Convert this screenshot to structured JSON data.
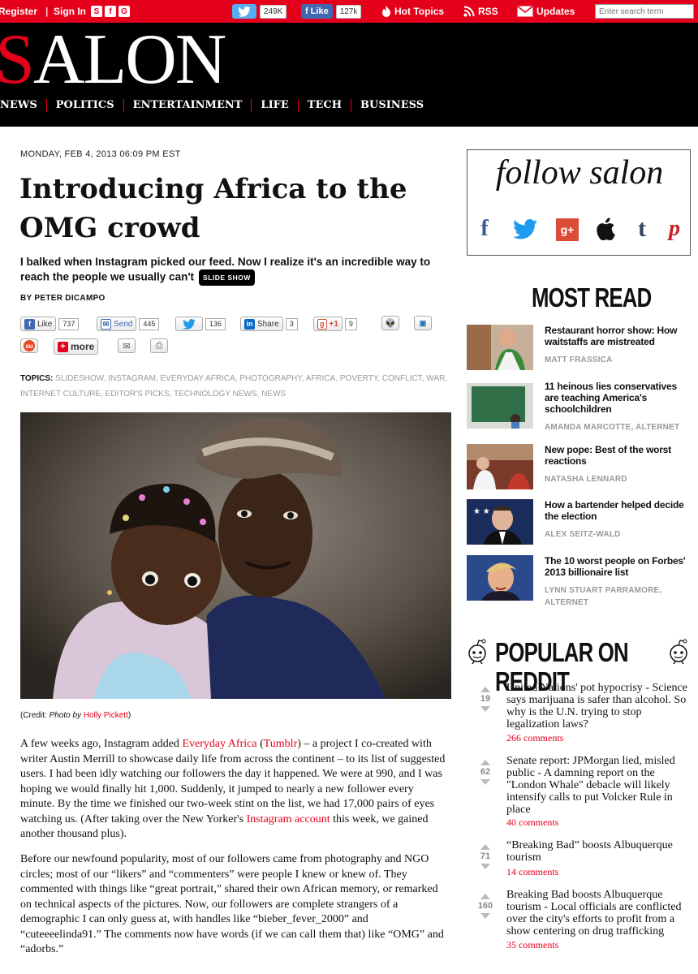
{
  "topbar": {
    "register": "Register",
    "sign_in": "Sign In",
    "social_letters": [
      "S",
      "f",
      "G"
    ],
    "twitter_count": "249K",
    "fb_like": "Like",
    "fb_count": "127k",
    "hot_topics": "Hot Topics",
    "rss": "RSS",
    "updates": "Updates",
    "search_placeholder": "Enter search term"
  },
  "header": {
    "logo_first": "S",
    "logo_rest": "ALON",
    "nav": [
      "NEWS",
      "POLITICS",
      "ENTERTAINMENT",
      "LIFE",
      "TECH",
      "BUSINESS"
    ]
  },
  "article": {
    "date": "MONDAY, FEB 4, 2013 06:09 PM EST",
    "title": "Introducing Africa to the OMG crowd",
    "dek": "I balked when Instagram picked our feed. Now I realize it's an incredible way to reach the people we usually can't",
    "slideshow": "SLIDE SHOW",
    "byline": "BY PETER DICAMPO",
    "share": {
      "like_label": "Like",
      "like_count": "737",
      "send_label": "Send",
      "send_count": "445",
      "tweet_count": "136",
      "linkedin_label": "Share",
      "linkedin_count": "3",
      "gplus_label": "+1",
      "gplus_count": "9",
      "more_label": "more"
    },
    "topics_label": "TOPICS:",
    "topics": [
      "SLIDESHOW",
      "INSTAGRAM",
      "EVERYDAY AFRICA",
      "PHOTOGRAPHY",
      "AFRICA",
      "POVERTY",
      "CONFLICT",
      "WAR",
      "INTERNET CULTURE",
      "EDITOR'S PICKS",
      "TECHNOLOGY NEWS",
      "NEWS"
    ],
    "credit_prefix": "(Credit: ",
    "credit_photo_by": "Photo by ",
    "credit_name": "Holly Pickett",
    "credit_suffix": ")",
    "p1_a": "A few weeks ago, Instagram added ",
    "p1_link1": "Everyday Africa",
    "p1_b": " (",
    "p1_link2": "Tumblr",
    "p1_c": ") – a project I co-created with writer Austin Merrill to showcase daily life from across the continent – to its list of suggested users. I had been idly watching our followers the day it happened. We were at 990, and I was hoping we would finally hit 1,000. Suddenly, it jumped to nearly a new follower every minute. By the time we finished our two-week stint on the list, we had 17,000 pairs of eyes watching us. (After taking over the New Yorker's ",
    "p1_link3": "Instagram account",
    "p1_d": " this week, we gained another thousand plus).",
    "p2": "Before our newfound popularity, most of our followers came from photography and NGO circles; most of our “likers” and “commenters” were people I knew or knew of. They commented with things like “great portrait,” shared their own African memory, or remarked on technical aspects of the pictures. Now, our followers are complete strangers of a demographic I can only guess at, with handles like “bieber_fever_2000” and “cuteeeelinda91.” The comments now have words (if we can call them that) like “OMG” and “adorbs.”"
  },
  "sidebar": {
    "follow_title": "follow salon",
    "most_read_title": "MOST READ",
    "most_read": [
      {
        "headline": "Restaurant horror show: How waitstaffs are mistreated",
        "author": "MATT FRASSICA"
      },
      {
        "headline": "11 heinous lies conservatives are teaching America's schoolchildren",
        "author": "AMANDA MARCOTTE, ALTERNET"
      },
      {
        "headline": "New pope: Best of the worst reactions",
        "author": "NATASHA LENNARD"
      },
      {
        "headline": "How a bartender helped decide the election",
        "author": "ALEX SEITZ-WALD"
      },
      {
        "headline": "The 10 worst people on Forbes' 2013 billionaire list",
        "author": "LYNN STUART PARRAMORE, ALTERNET"
      }
    ],
    "reddit_title": "POPULAR ON REDDIT",
    "reddit": [
      {
        "score": "19",
        "headline": "United Nations' pot hypocrisy - Science says marijuana is safer than alcohol. So why is the U.N. trying to stop legalization laws?",
        "comments": "266 comments"
      },
      {
        "score": "62",
        "headline": "Senate report: JPMorgan lied, misled public - A damning report on the \"London Whale\" debacle will likely intensify calls to put Volcker Rule in place",
        "comments": "40 comments"
      },
      {
        "score": "71",
        "headline": "“Breaking Bad” boosts Albuquerque tourism",
        "comments": "14 comments"
      },
      {
        "score": "160",
        "headline": "Breaking Bad boosts Albuquerque tourism - Local officials are conflicted over the city's efforts to profit from a show centering on drug trafficking",
        "comments": "35 comments"
      }
    ]
  }
}
